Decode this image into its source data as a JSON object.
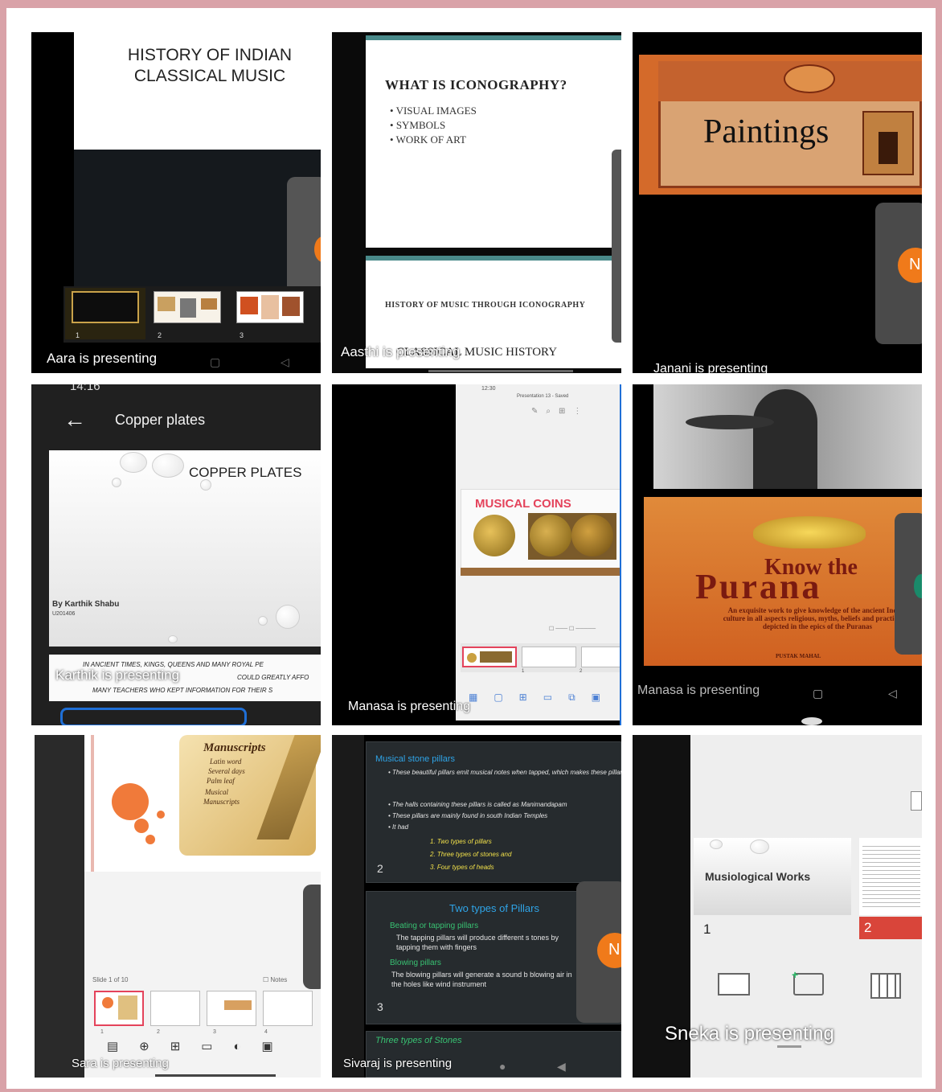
{
  "tiles": {
    "t1": {
      "slide_title": "HISTORY OF INDIAN CLASSICAL MUSIC",
      "thumb_numbers": [
        "1",
        "2",
        "3"
      ],
      "presenter": "Aara is presenting"
    },
    "t2": {
      "slide_title": "WHAT IS ICONOGRAPHY?",
      "bullets": [
        "VISUAL IMAGES",
        "SYMBOLS",
        "WORK OF ART"
      ],
      "slide2_title": "HISTORY OF MUSIC THROUGH ICONOGRAPHY",
      "slide3_text": "CLASSICAL MUSIC HISTORY",
      "presenter": "Aasthi is presenting"
    },
    "t3": {
      "slide_title": "Paintings",
      "avatar_letter": "N",
      "presenter": "Janani is presenting"
    },
    "t4": {
      "status_time": "14:16",
      "header_title": "Copper plates",
      "slide_title": "COPPER PLATES",
      "author": "By Karthik Shabu",
      "author_id": "U201406",
      "notes": [
        "IN ANCIENT TIMES, KINGS, QUEENS AND MANY ROYAL PE",
        "COULD GREATLY AFFO",
        "MANY TEACHERS WHO KEPT INFORMATION FOR THEIR S"
      ],
      "presenter": "Karthik is presenting"
    },
    "t5": {
      "status_time": "12:30",
      "app_title": "Presentation 13 - Saved",
      "slide_title": "MUSICAL COINS",
      "slide_number_1": "1",
      "slide_number_2": "2",
      "presenter": "Manasa is presenting"
    },
    "t6": {
      "book_title_1": "Know the",
      "book_title_2": "Purana",
      "book_subtitle": "An exquisite work to give knowledge of the ancient Indian culture in all aspects religious, myths, beliefs and practices as depicted in the epics of the Puranas",
      "publisher": "PUSTAK MAHAL",
      "presenter": "Manasa is presenting"
    },
    "t7": {
      "slide_title": "Manuscripts",
      "slide_items": [
        "Latin word",
        "Several days",
        "Palm leaf",
        "Musical",
        "Manuscripts"
      ],
      "slide_counter": "Slide 1 of 10",
      "notes_label": "Notes",
      "thumb_numbers": [
        "1",
        "2",
        "3",
        "4"
      ],
      "presenter": "Sara is presenting"
    },
    "t8": {
      "slide1_title": "Musical stone pillars",
      "slide1_bullets": [
        "These beautiful pillars emit musical notes when tapped, which makes these pillars be unique and we called them musical stone pillars",
        "The halls containing these pillars is called as Manimandapam",
        "These pillars are mainly found in south Indian Temples",
        "It had"
      ],
      "slide1_sub": [
        "1. Two types of pillars",
        "2. Three types of stones and",
        "3. Four types of heads"
      ],
      "slide1_number": "2",
      "slide2_title": "Two types of Pillars",
      "slide2_h1": "Beating or tapping pillars",
      "slide2_p1": "The tapping pillars will produce different s tones by tapping them with fingers",
      "slide2_h2": "Blowing pillars",
      "slide2_p2": "The blowing pillars will generate a sound b blowing air in the holes like wind instrument",
      "slide2_number": "3",
      "slide3_title": "Three types of Stones",
      "avatar_letter": "N",
      "presenter": "Sivaraj is presenting"
    },
    "t9": {
      "slide_title": "Musiological Works",
      "slide_number_1": "1",
      "slide_number_2": "2",
      "presenter": "Sneka is presenting"
    }
  },
  "colors": {
    "border": "#d9a2a8",
    "accent_orange": "#f07a1a",
    "coin_red": "#e4435b",
    "stone_slide_bg": "#262b2e",
    "stone_title": "#2fa4e7",
    "stone_green": "#38c172"
  }
}
